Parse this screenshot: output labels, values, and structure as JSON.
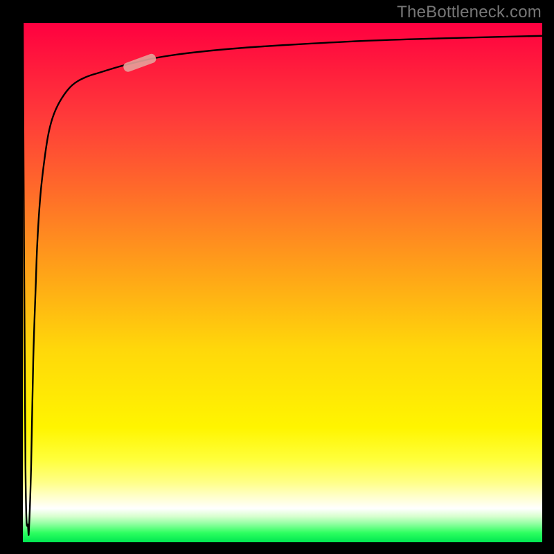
{
  "attribution": "TheBottleneck.com",
  "chart_data": {
    "type": "line",
    "title": "",
    "xlabel": "",
    "ylabel": "",
    "xlim": [
      0,
      1
    ],
    "ylim": [
      0,
      1
    ],
    "background_gradient": {
      "direction": "vertical",
      "stops": [
        {
          "pos": 0.0,
          "color": "#ff0040"
        },
        {
          "pos": 0.18,
          "color": "#ff3a3a"
        },
        {
          "pos": 0.48,
          "color": "#ffa318"
        },
        {
          "pos": 0.78,
          "color": "#fff500"
        },
        {
          "pos": 0.94,
          "color": "#ffffff"
        },
        {
          "pos": 1.0,
          "color": "#00e651"
        }
      ]
    },
    "series": [
      {
        "name": "curve",
        "color": "#000000",
        "x": [
          0.0,
          0.005,
          0.01,
          0.012,
          0.016,
          0.02,
          0.025,
          0.028,
          0.034,
          0.042,
          0.05,
          0.06,
          0.075,
          0.095,
          0.12,
          0.15,
          0.19,
          0.23,
          0.27,
          0.32,
          0.4,
          0.5,
          0.65,
          0.8,
          1.0
        ],
        "y": [
          1.0,
          0.15,
          0.03,
          0.03,
          0.15,
          0.35,
          0.5,
          0.58,
          0.67,
          0.74,
          0.79,
          0.825,
          0.855,
          0.88,
          0.895,
          0.905,
          0.917,
          0.927,
          0.935,
          0.942,
          0.95,
          0.957,
          0.965,
          0.97,
          0.975
        ]
      }
    ],
    "marker": {
      "x": 0.225,
      "y": 0.923,
      "length": 0.065,
      "width": 0.018,
      "angle_deg": -20,
      "color": "#e6a19a"
    }
  }
}
